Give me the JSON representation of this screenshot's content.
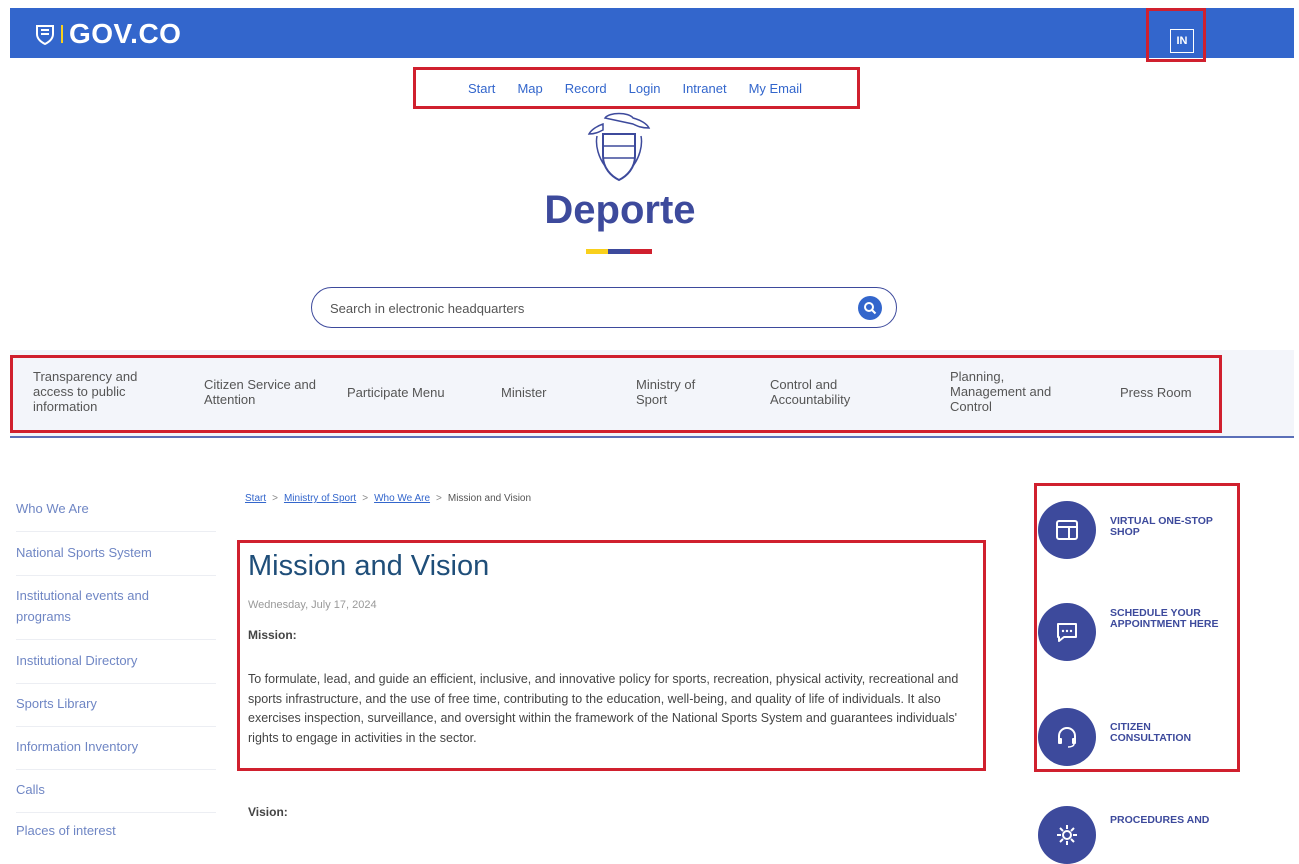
{
  "header": {
    "logo_text": "GOV.CO",
    "lang_button": "IN"
  },
  "utility_links": [
    "Start",
    "Map",
    "Record",
    "Login",
    "Intranet",
    "My Email"
  ],
  "brand": {
    "name": "Deporte",
    "flag_colors": [
      "#f9d01c",
      "#3d4a9c",
      "#d0202e"
    ]
  },
  "search": {
    "placeholder": "Search in electronic headquarters"
  },
  "nav": [
    "Transparency and access to public information",
    "Citizen Service and Attention",
    "Participate Menu",
    "Minister",
    "Ministry of Sport",
    "Control and Accountability",
    "Planning, Management and Control",
    "Press Room"
  ],
  "sidebar": [
    "Who We Are",
    "National Sports System",
    "Institutional events and programs",
    "Institutional Directory",
    "Sports Library",
    "Information Inventory",
    "Calls",
    "Places of interest"
  ],
  "breadcrumb": {
    "items": [
      "Start",
      "Ministry of Sport",
      "Who We Are"
    ],
    "current": "Mission and Vision",
    "separator": ">"
  },
  "article": {
    "title": "Mission and Vision",
    "date": "Wednesday, July 17, 2024",
    "mission_label": "Mission:",
    "mission_text": "To formulate, lead, and guide an efficient, inclusive, and innovative policy for sports, recreation, physical activity, recreational and sports infrastructure, and the use of free time, contributing to the education, well-being, and quality of life of individuals. It also exercises inspection, surveillance, and oversight within the framework of the National Sports System and guarantees individuals' rights to engage in activities in the sector.",
    "vision_label": "Vision:"
  },
  "services": [
    {
      "label": "VIRTUAL ONE-STOP SHOP",
      "icon": "window-icon"
    },
    {
      "label": "SCHEDULE YOUR APPOINTMENT HERE",
      "icon": "chat-icon"
    },
    {
      "label": "CITIZEN CONSULTATION",
      "icon": "headset-icon"
    },
    {
      "label": "PROCEDURES AND",
      "icon": "gear-icon"
    }
  ],
  "colors": {
    "gov_blue": "#3366cc",
    "brand_navy": "#3d4a9c",
    "highlight_red": "#d0202e",
    "link_blue": "#3366cc"
  }
}
